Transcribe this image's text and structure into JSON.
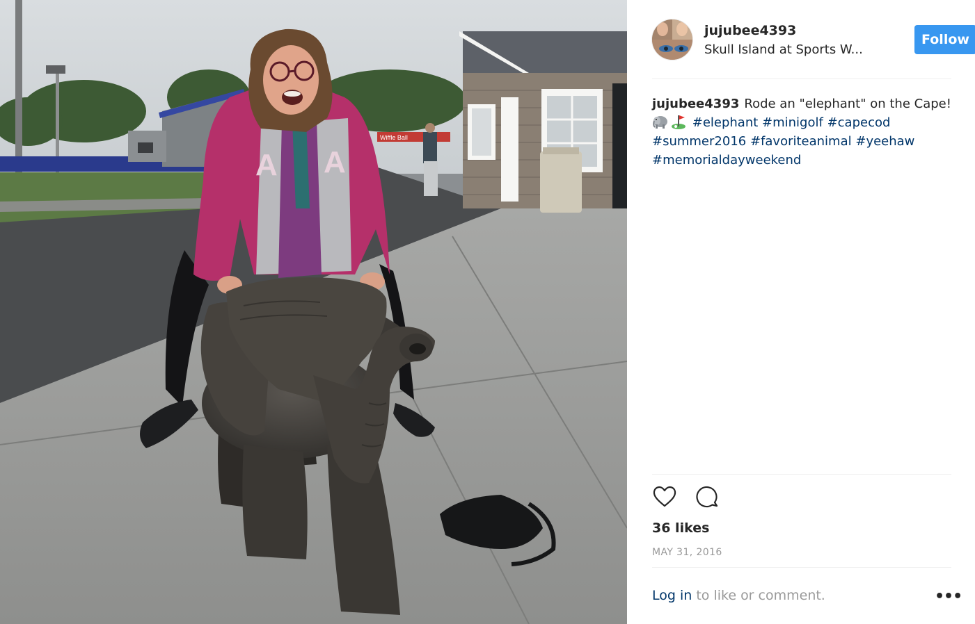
{
  "photo": {
    "subject": "elephant-statue",
    "sign_text": "Wiffle Ball"
  },
  "post": {
    "username": "jujubee4393",
    "location": "Skull Island at Sports W...",
    "follow_label": "Follow",
    "caption": {
      "username": "jujubee4393",
      "text": "Rode an \"elephant\" on the Cape!",
      "emojis": [
        "elephant-emoji",
        "golf-flag-emoji"
      ],
      "hashtags": [
        "#elephant",
        "#minigolf",
        "#capecod",
        "#summer2016",
        "#favoriteanimal",
        "#yeehaw",
        "#memorialdayweekend"
      ]
    },
    "actions": {
      "like_icon": "heart-icon",
      "comment_icon": "comment-icon"
    },
    "likes": "36 likes",
    "date": "MAY 31, 2016",
    "login_link": "Log in",
    "login_suffix": " to like or comment.",
    "more_icon": "more-options-icon"
  },
  "colors": {
    "follow_button": "#3897f0",
    "hashtag": "#003569",
    "muted": "#999999",
    "text": "#262626"
  }
}
